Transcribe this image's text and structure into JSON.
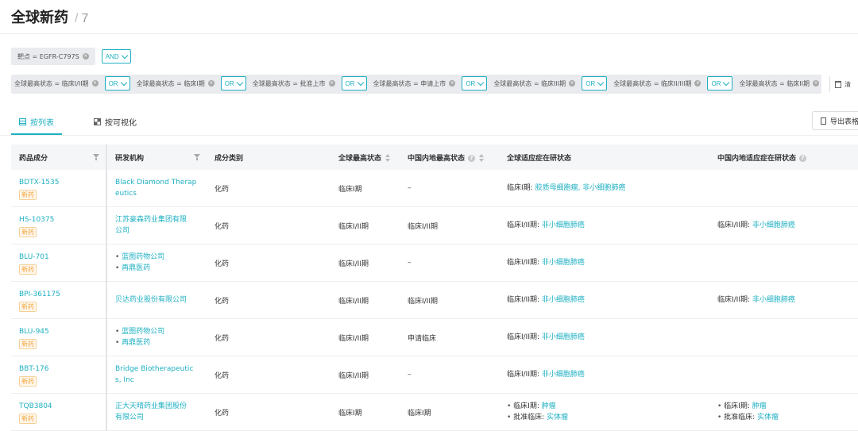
{
  "page": {
    "title": "全球新药",
    "separator": "/",
    "count": "7"
  },
  "filters": {
    "target_chip": "靶点 = EGFR-C797S",
    "logic_and": "AND",
    "status_chips": [
      "全球最高状态 = 临床I/II期",
      "全球最高状态 = 临床I期",
      "全球最高状态 = 批准上市",
      "全球最高状态 = 申请上市",
      "全球最高状态 = 临床III期",
      "全球最高状态 = 临床II/III期",
      "全球最高状态 = 临床II期"
    ],
    "logic_or": "OR",
    "clear_label": "清"
  },
  "tabs": [
    {
      "label": "按列表",
      "icon": "list-icon",
      "active": true
    },
    {
      "label": "按可视化",
      "icon": "grid-icon",
      "active": false
    }
  ],
  "export_label": "导出表格",
  "table": {
    "columns": [
      "药品成分",
      "研发机构",
      "成分类别",
      "全球最高状态",
      "中国内地最高状态",
      "全球适应症在研状态",
      "中国内地适应症在研状态"
    ],
    "new_drug_badge": "新药",
    "rows": [
      {
        "drug": "BDTX-1535",
        "orgs": [
          "Black Diamond Therap",
          "eutics"
        ],
        "org_multi": false,
        "category": "化药",
        "global_status": "临床I期",
        "cn_status": "–",
        "global_ind": [
          {
            "stage": "临床I期:",
            "items": [
              "胶质母细胞瘤,",
              "非小细胞肺癌"
            ]
          }
        ],
        "cn_ind": []
      },
      {
        "drug": "HS-10375",
        "orgs": [
          "江苏豪森药业集团有限",
          "公司"
        ],
        "org_multi": false,
        "category": "化药",
        "global_status": "临床I/II期",
        "cn_status": "临床I/II期",
        "global_ind": [
          {
            "stage": "临床I/II期:",
            "items": [
              "非小细胞肺癌"
            ]
          }
        ],
        "cn_ind": [
          {
            "stage": "临床I/II期:",
            "items": [
              "非小细胞肺癌"
            ]
          }
        ]
      },
      {
        "drug": "BLU-701",
        "orgs": [
          "蓝图药物公司",
          "再鼎医药"
        ],
        "org_multi": true,
        "category": "化药",
        "global_status": "临床I/II期",
        "cn_status": "–",
        "global_ind": [
          {
            "stage": "临床I/II期:",
            "items": [
              "非小细胞肺癌"
            ]
          }
        ],
        "cn_ind": []
      },
      {
        "drug": "BPI-361175",
        "orgs": [
          "贝达药业股份有限公司"
        ],
        "org_multi": false,
        "category": "化药",
        "global_status": "临床I/II期",
        "cn_status": "临床I/II期",
        "global_ind": [
          {
            "stage": "临床I/II期:",
            "items": [
              "非小细胞肺癌"
            ]
          }
        ],
        "cn_ind": [
          {
            "stage": "临床I/II期:",
            "items": [
              "非小细胞肺癌"
            ]
          }
        ]
      },
      {
        "drug": "BLU-945",
        "orgs": [
          "蓝图药物公司",
          "再鼎医药"
        ],
        "org_multi": true,
        "category": "化药",
        "global_status": "临床I/II期",
        "cn_status": "申请临床",
        "global_ind": [
          {
            "stage": "临床I/II期:",
            "items": [
              "非小细胞肺癌"
            ]
          }
        ],
        "cn_ind": []
      },
      {
        "drug": "BBT-176",
        "orgs": [
          "Bridge Biotherapeutic",
          "s, Inc"
        ],
        "org_multi": false,
        "category": "化药",
        "global_status": "临床I/II期",
        "cn_status": "–",
        "global_ind": [
          {
            "stage": "临床I/II期:",
            "items": [
              "非小细胞肺癌"
            ]
          }
        ],
        "cn_ind": []
      },
      {
        "drug": "TQB3804",
        "orgs": [
          "正大天晴药业集团股份",
          "有限公司"
        ],
        "org_multi": false,
        "category": "化药",
        "global_status": "临床I期",
        "cn_status": "临床I期",
        "global_ind": [
          {
            "stage": "临床I期:",
            "items": [
              "肿瘤"
            ],
            "bullet": true
          },
          {
            "stage": "批准临床:",
            "items": [
              "实体瘤"
            ],
            "bullet": true
          }
        ],
        "cn_ind": [
          {
            "stage": "临床I期:",
            "items": [
              "肿瘤"
            ],
            "bullet": true
          },
          {
            "stage": "批准临床:",
            "items": [
              "实体瘤"
            ],
            "bullet": true
          }
        ]
      }
    ]
  }
}
